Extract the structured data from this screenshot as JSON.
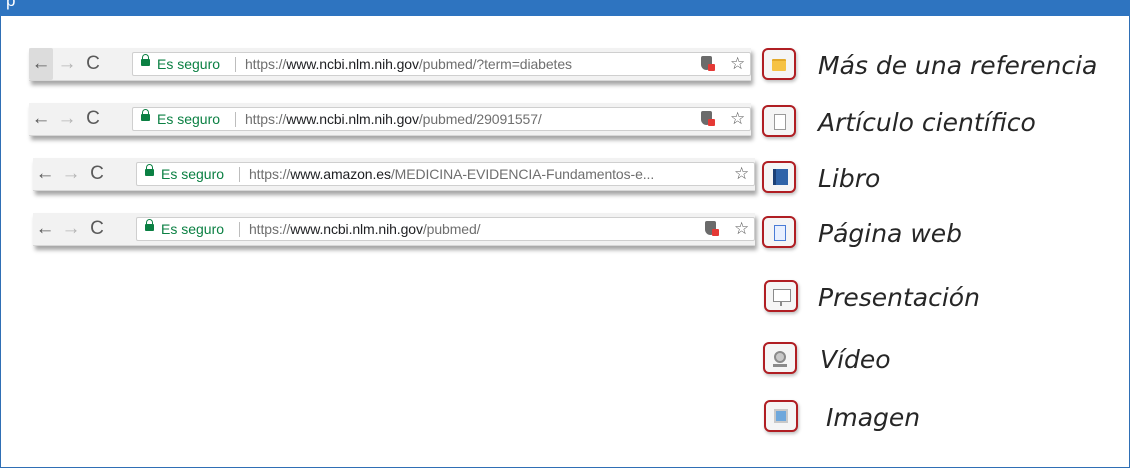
{
  "header": {
    "band_text": "p"
  },
  "browser_rows": [
    {
      "back_active": true,
      "secure_label": "Es seguro",
      "url_prefix": "https://",
      "url_domain": "www.ncbi.nlm.nih.gov",
      "url_path": "/pubmed/?term=diabetes",
      "has_shield": true
    },
    {
      "back_active": false,
      "secure_label": "Es seguro",
      "url_prefix": "https://",
      "url_domain": "www.ncbi.nlm.nih.gov",
      "url_path": "/pubmed/29091557/",
      "has_shield": true
    },
    {
      "back_active": false,
      "secure_label": "Es seguro",
      "url_prefix": "https://",
      "url_domain": "www.amazon.es",
      "url_path": "/MEDICINA-EVIDENCIA-Fundamentos-e...",
      "has_shield": false
    },
    {
      "back_active": false,
      "secure_label": "Es seguro",
      "url_prefix": "https://",
      "url_domain": "www.ncbi.nlm.nih.gov",
      "url_path": "/pubmed/",
      "has_shield": true
    }
  ],
  "nav_glyphs": {
    "back": "←",
    "forward": "→",
    "reload": "C",
    "star": "☆"
  },
  "legend": [
    {
      "icon": "folder-icon",
      "label": "Más de una referencia"
    },
    {
      "icon": "document-icon",
      "label": "Artículo científico"
    },
    {
      "icon": "book-icon",
      "label": "Libro"
    },
    {
      "icon": "webpage-icon",
      "label": "Página web"
    },
    {
      "icon": "presentation-icon",
      "label": "Presentación"
    },
    {
      "icon": "video-icon",
      "label": "Vídeo"
    },
    {
      "icon": "image-icon",
      "label": "Imagen"
    }
  ]
}
